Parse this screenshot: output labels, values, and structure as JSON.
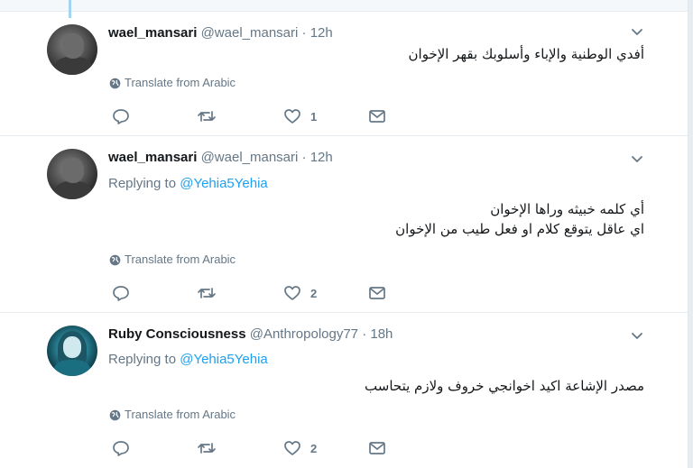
{
  "tweets": [
    {
      "name": "wael_mansari",
      "handle": "@wael_mansari",
      "dot": "·",
      "time": "12h",
      "replying": null,
      "lines": [
        "أفدي الوطنية والإباء وأسلوبك بقهر الإخوان"
      ],
      "translate": "Translate from Arabic",
      "likes": "1",
      "avatar": "dark-portrait"
    },
    {
      "name": "wael_mansari",
      "handle": "@wael_mansari",
      "dot": "·",
      "time": "12h",
      "replying": {
        "prefix": "Replying to",
        "mention": "@Yehia5Yehia"
      },
      "lines": [
        "أي كلمه خبيثه وراها الإخوان",
        "اي عاقل يتوقع كلام او فعل طيب من الإخوان"
      ],
      "translate": "Translate from Arabic",
      "likes": "2",
      "avatar": "dark-portrait"
    },
    {
      "name": "Ruby Consciousness",
      "handle": "@Anthropology77",
      "dot": "·",
      "time": "18h",
      "replying": {
        "prefix": "Replying to",
        "mention": "@Yehia5Yehia"
      },
      "lines": [
        "مصدر الإشاعة اكيد اخوانجي خروف ولازم يتحاسب"
      ],
      "translate": "Translate from Arabic",
      "likes": "2",
      "avatar": "teal-portrait"
    }
  ],
  "colors": {
    "accent": "#1da1f2",
    "muted": "#657786",
    "thread_line": "#a3d4f2"
  },
  "icons": [
    "chevron-down-icon",
    "globe-icon",
    "reply-icon",
    "retweet-icon",
    "like-icon",
    "direct-message-icon"
  ]
}
